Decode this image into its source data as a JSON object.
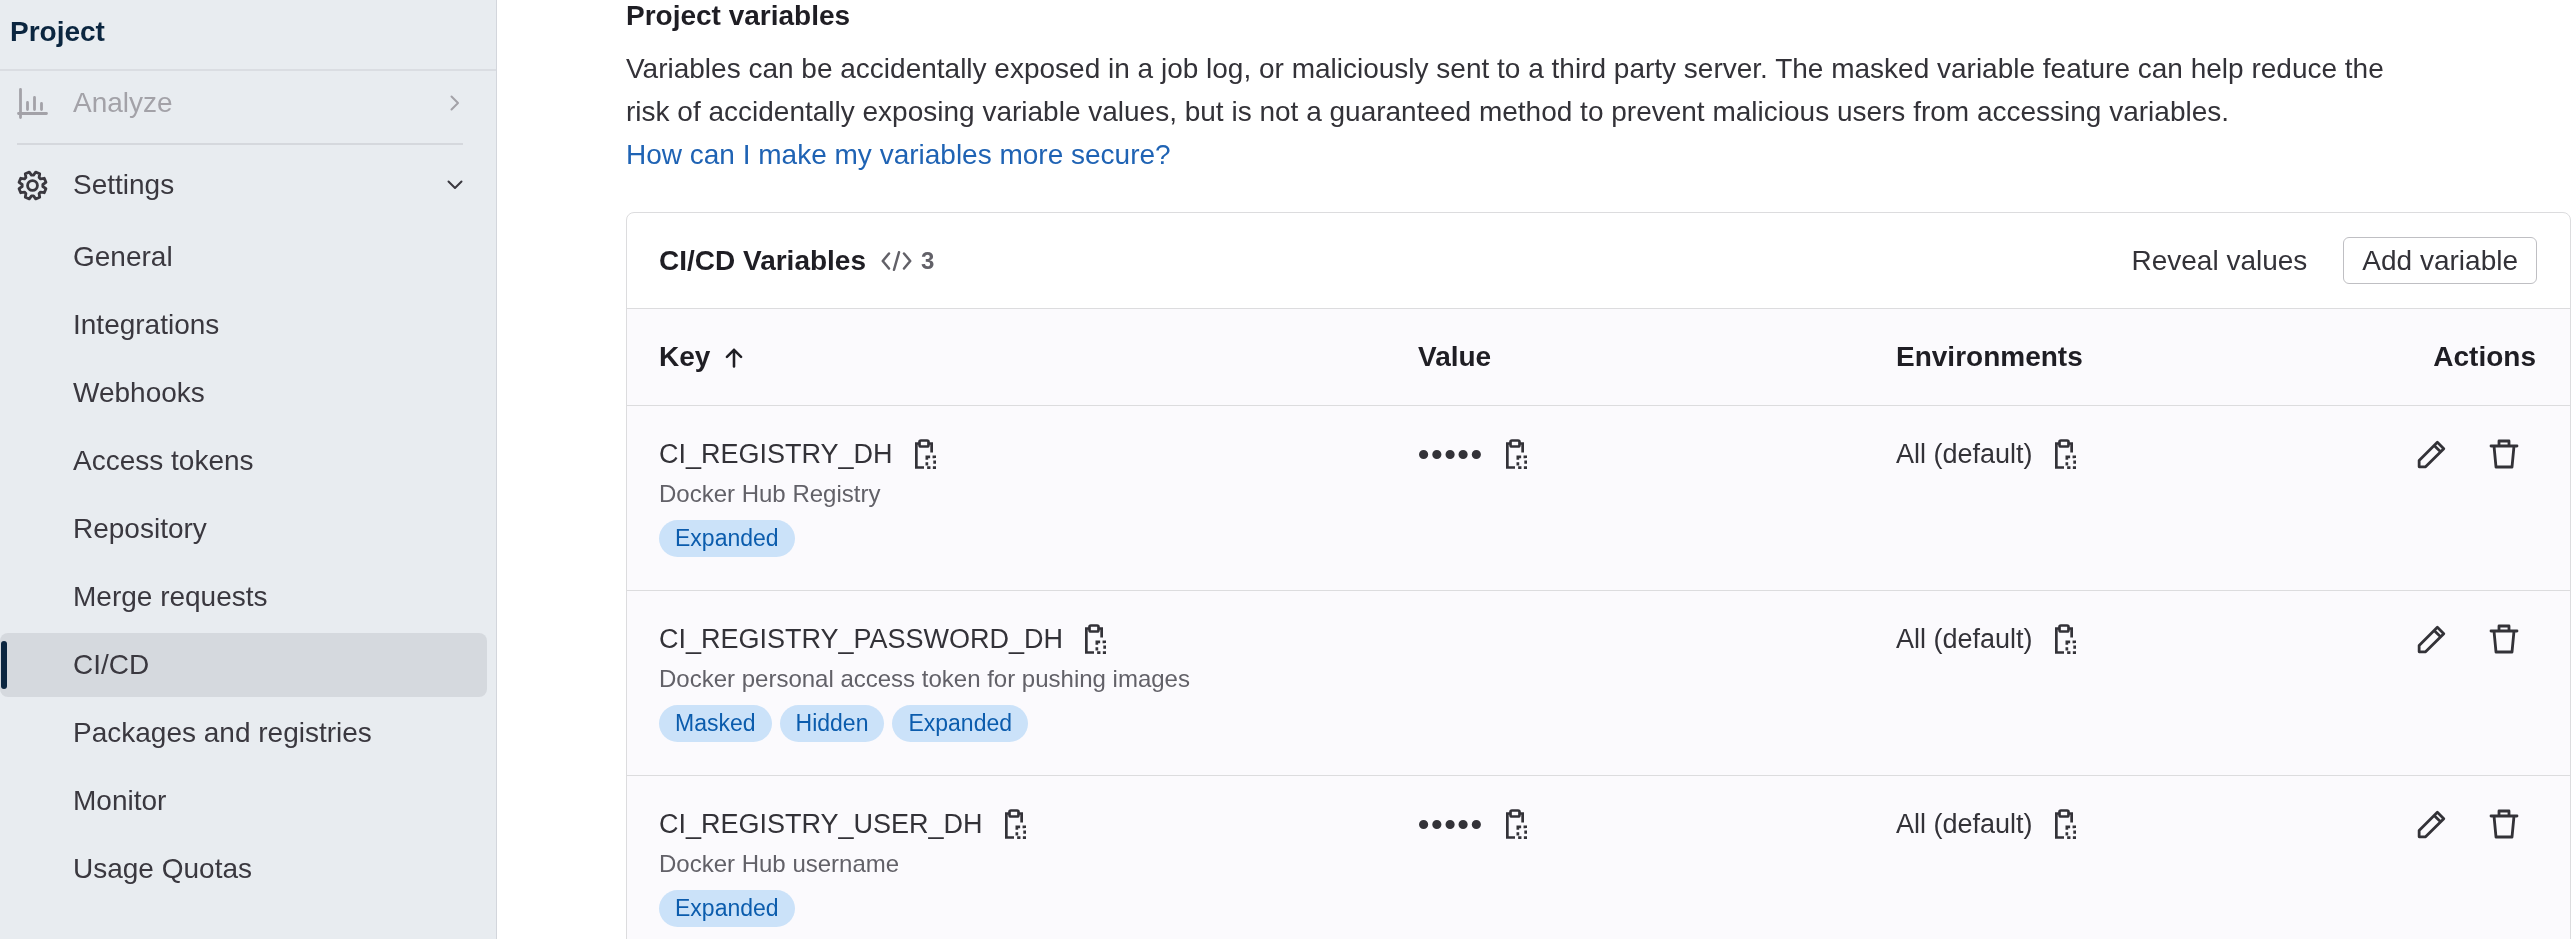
{
  "sidebar": {
    "title": "Project",
    "sections": [
      {
        "label": "Analyze",
        "expanded": false,
        "disabled": true
      },
      {
        "label": "Settings",
        "expanded": true,
        "disabled": false,
        "children": [
          {
            "label": "General",
            "selected": false
          },
          {
            "label": "Integrations",
            "selected": false
          },
          {
            "label": "Webhooks",
            "selected": false
          },
          {
            "label": "Access tokens",
            "selected": false
          },
          {
            "label": "Repository",
            "selected": false
          },
          {
            "label": "Merge requests",
            "selected": false
          },
          {
            "label": "CI/CD",
            "selected": true
          },
          {
            "label": "Packages and registries",
            "selected": false
          },
          {
            "label": "Monitor",
            "selected": false
          },
          {
            "label": "Usage Quotas",
            "selected": false
          }
        ]
      }
    ]
  },
  "main": {
    "title": "Project variables",
    "description": "Variables can be accidentally exposed in a job log, or maliciously sent to a third party server. The masked variable feature can help reduce the risk of accidentally exposing variable values, but is not a guaranteed method to prevent malicious users from accessing variables.",
    "link": "How can I make my variables more secure?"
  },
  "variables": {
    "title": "CI/CD Variables",
    "count": "3",
    "reveal_button": "Reveal values",
    "add_button": "Add variable",
    "columns": [
      {
        "label": "Key",
        "sorted": true
      },
      {
        "label": "Value",
        "sorted": false
      },
      {
        "label": "Environments",
        "sorted": false
      },
      {
        "label": "Actions",
        "sorted": false
      }
    ],
    "rows": [
      {
        "key": "CI_REGISTRY_DH",
        "description": "Docker Hub Registry",
        "badges": [
          "Expanded"
        ],
        "value": "•••••",
        "environment": "All (default)"
      },
      {
        "key": "CI_REGISTRY_PASSWORD_DH",
        "description": "Docker personal access token for pushing images",
        "badges": [
          "Masked",
          "Hidden",
          "Expanded"
        ],
        "environment": "All (default)"
      },
      {
        "key": "CI_REGISTRY_USER_DH",
        "description": "Docker Hub username",
        "badges": [
          "Expanded"
        ],
        "value": "•••••",
        "environment": "All (default)"
      }
    ]
  }
}
